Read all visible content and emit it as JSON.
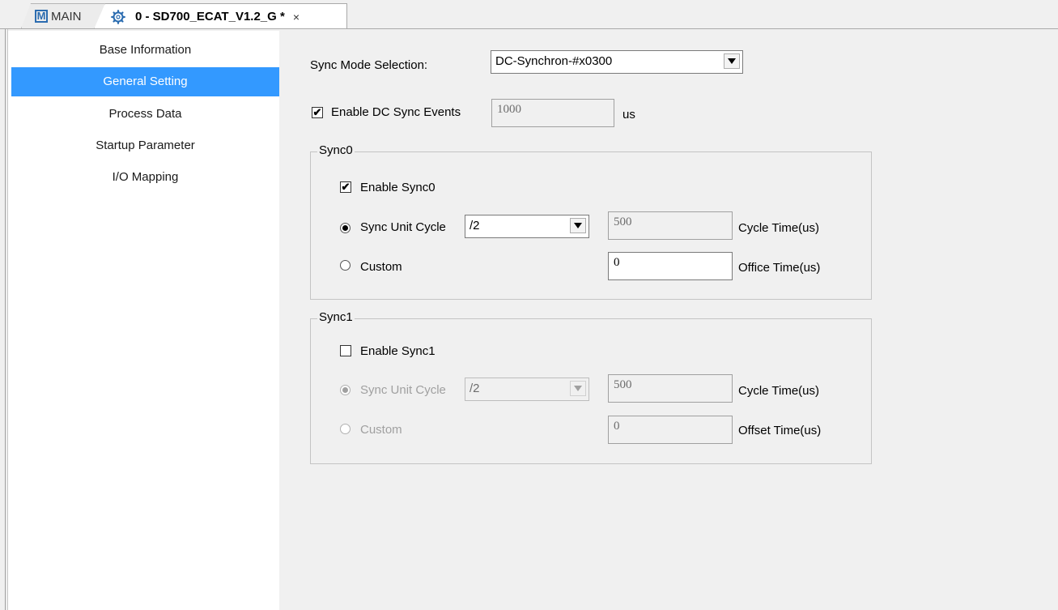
{
  "tabs": {
    "main_label": "MAIN",
    "active_label": "0 - SD700_ECAT_V1.2_G *",
    "close_glyph": "×",
    "main_icon": "m-logo-icon",
    "active_icon": "gear-icon"
  },
  "sidebar": {
    "items": [
      {
        "label": "Base Information",
        "selected": false
      },
      {
        "label": "General Setting",
        "selected": true
      },
      {
        "label": "Process Data",
        "selected": false
      },
      {
        "label": "Startup Parameter",
        "selected": false
      },
      {
        "label": "I/O Mapping",
        "selected": false
      }
    ]
  },
  "general": {
    "sync_mode_label": "Sync Mode Selection:",
    "sync_mode_value": "DC-Synchron-#x0300",
    "enable_dc_label": "Enable DC Sync Events",
    "enable_dc_checked": true,
    "dc_value": "1000",
    "dc_unit": "us"
  },
  "sync0": {
    "title": "Sync0",
    "enable_label": "Enable Sync0",
    "enable_checked": true,
    "unit_cycle_label": "Sync Unit Cycle",
    "unit_cycle_value": "/2",
    "cycle_time_value": "500",
    "cycle_time_label": "Cycle Time(us)",
    "custom_label": "Custom",
    "offset_value": "0",
    "offset_label": "Office Time(us)"
  },
  "sync1": {
    "title": "Sync1",
    "enable_label": "Enable Sync1",
    "enable_checked": false,
    "unit_cycle_label": "Sync Unit Cycle",
    "unit_cycle_value": "/2",
    "cycle_time_value": "500",
    "cycle_time_label": "Cycle Time(us)",
    "custom_label": "Custom",
    "offset_value": "0",
    "offset_label": "Offset Time(us)"
  },
  "colors": {
    "selection": "#3399ff",
    "tab_icon": "#2b6cb0"
  }
}
